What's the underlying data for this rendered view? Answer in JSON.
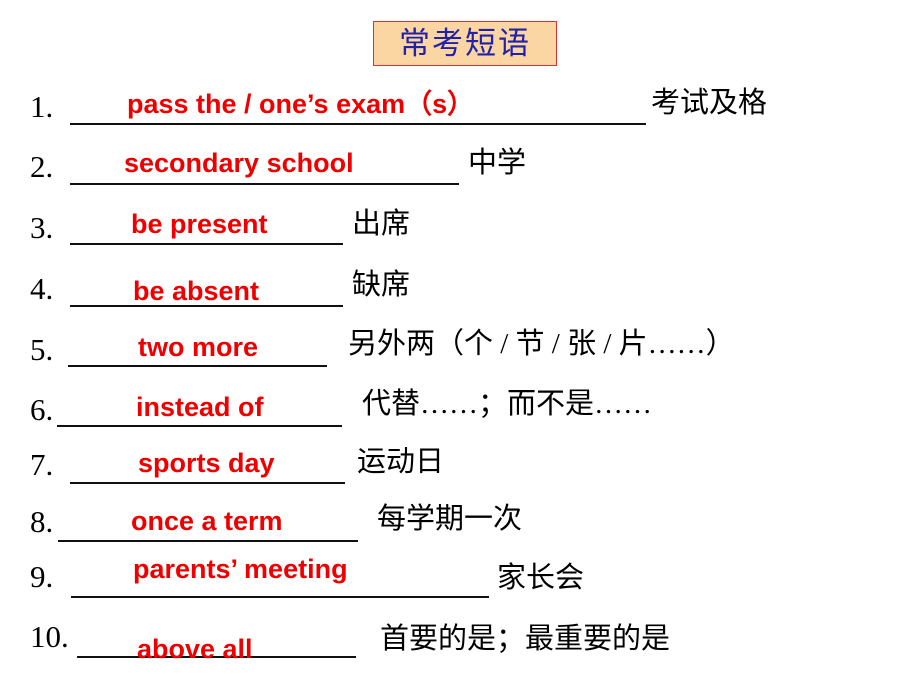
{
  "slide": {
    "title": "常考短语",
    "title_bg": "#fbd5a2",
    "title_border": "#e03030",
    "title_color": "#2222a8",
    "answer_color": "#ee0000",
    "text_color": "#000000",
    "background": "#ffffff"
  },
  "items": [
    {
      "number": "1.",
      "answer": "pass the / one’s exam（s）",
      "gloss": "考试及格"
    },
    {
      "number": "2.",
      "answer": "secondary school",
      "gloss": "中学"
    },
    {
      "number": "3.",
      "answer": "be present",
      "gloss": "出席"
    },
    {
      "number": "4.",
      "answer": "be absent",
      "gloss": "缺席"
    },
    {
      "number": "5.",
      "answer": "two more",
      "gloss": "另外两（个 / 节 / 张 / 片……）"
    },
    {
      "number": "6.",
      "answer": "instead of",
      "gloss": "代替……；而不是……"
    },
    {
      "number": "7.",
      "answer": "sports day",
      "gloss": "运动日"
    },
    {
      "number": "8.",
      "answer": "once a term",
      "gloss": "每学期一次"
    },
    {
      "number": "9.",
      "answer": "parents’ meeting",
      "gloss": "家长会"
    },
    {
      "number": "10.",
      "answer": "above all",
      "gloss": "首要的是；最重要的是"
    }
  ]
}
